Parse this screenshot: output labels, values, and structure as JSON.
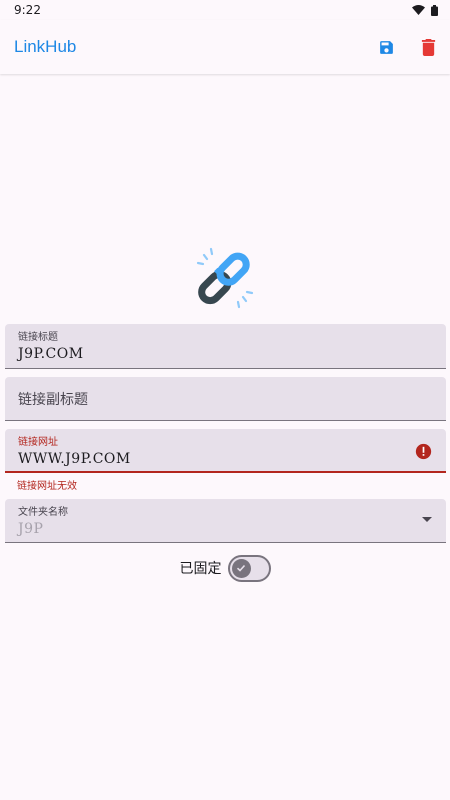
{
  "status_bar": {
    "time": "9:22",
    "wifi_icon": "wifi-icon",
    "battery_icon": "battery-icon"
  },
  "app_bar": {
    "title": "LinkHub",
    "save_icon": "save-icon",
    "delete_icon": "delete-icon"
  },
  "colors": {
    "accent": "#1e88e5",
    "delete": "#e53935",
    "error": "#b3261e",
    "field_bg": "#e7e0ea",
    "background": "#fdf8fc"
  },
  "hero": {
    "icon": "chain-link-icon"
  },
  "form": {
    "title_field": {
      "label": "链接标题",
      "value": "J9P.COM"
    },
    "subtitle_field": {
      "placeholder": "链接副标题"
    },
    "url_field": {
      "label": "链接网址",
      "value": "WWW.J9P.COM",
      "error": "链接网址无效"
    },
    "folder_field": {
      "label": "文件夹名称",
      "value": "J9P"
    },
    "pin": {
      "label": "已固定",
      "checked": true
    }
  }
}
